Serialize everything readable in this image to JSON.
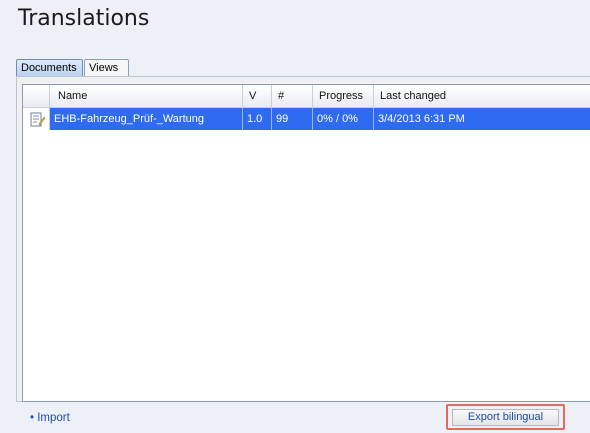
{
  "page": {
    "title": "Translations"
  },
  "tabs": [
    {
      "label": "Documents",
      "active": true
    },
    {
      "label": "Views",
      "active": false
    }
  ],
  "table": {
    "columns": [
      "Name",
      "V",
      "#",
      "Progress",
      "Last changed"
    ],
    "rows": [
      {
        "name": "EHB-Fahrzeug_Prüf-_Wartung",
        "v": "1.0",
        "count": "99",
        "progress": "0% / 0%",
        "last_changed": "3/4/2013 6:31 PM",
        "selected": true,
        "icon": "document-edit-icon"
      }
    ]
  },
  "footer": {
    "import_label": "• Import",
    "export_label": "Export bilingual"
  },
  "colors": {
    "selection": "#2f6bf0",
    "highlight_border": "#e26b5b",
    "link": "#1b4ea8"
  }
}
